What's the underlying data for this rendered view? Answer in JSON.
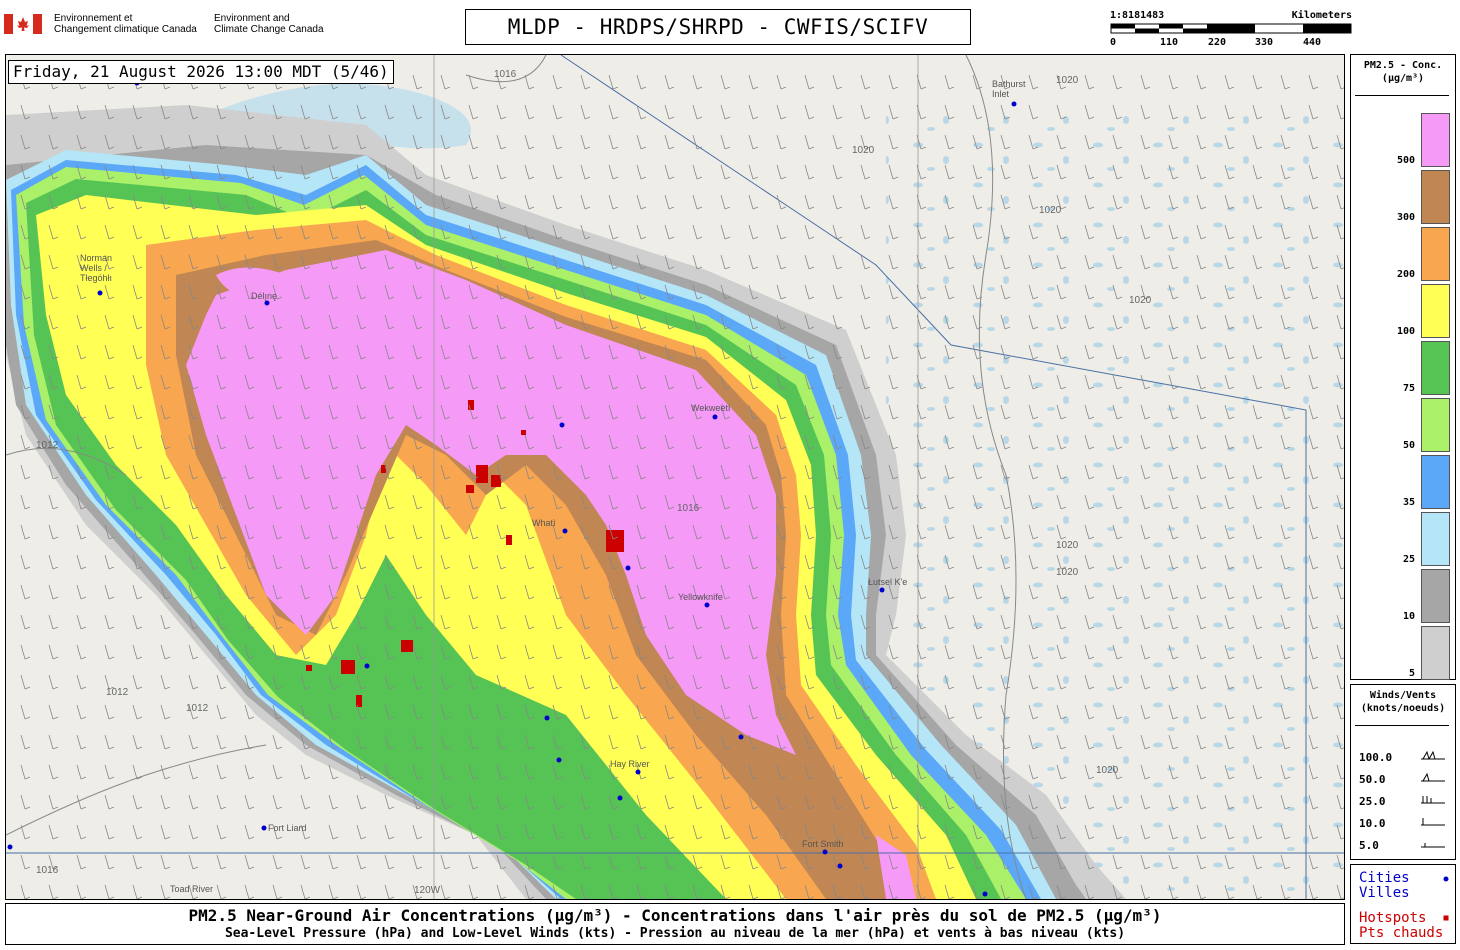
{
  "agency": {
    "fr_line1": "Environnement et",
    "fr_line2": "Changement climatique Canada",
    "en_line1": "Environment and",
    "en_line2": "Climate Change Canada",
    "flag_color": "#d52b1e"
  },
  "title": "MLDP - HRDPS/SHRPD - CWFIS/SCIFV",
  "scale": {
    "ratio": "1:8181483",
    "unit": "Kilometers",
    "ticks": [
      "0",
      "110",
      "220",
      "330",
      "440"
    ]
  },
  "timestamp": "Friday, 21 August 2026 13:00 MDT (5/46)",
  "legend_concentration": {
    "title_line1": "PM2.5 - Conc.",
    "title_line2": "(µg/m³)",
    "levels": [
      {
        "label": "500",
        "color": "#f59af6"
      },
      {
        "label": "300",
        "color": "#c08654"
      },
      {
        "label": "200",
        "color": "#f8a64f"
      },
      {
        "label": "100",
        "color": "#ffff55"
      },
      {
        "label": "75",
        "color": "#55c455"
      },
      {
        "label": "50",
        "color": "#aaf069"
      },
      {
        "label": "35",
        "color": "#5aa8f7"
      },
      {
        "label": "25",
        "color": "#b4e6f8"
      },
      {
        "label": "10",
        "color": "#a6a6a6"
      },
      {
        "label": "5",
        "color": "#cfcfcf"
      }
    ]
  },
  "legend_wind": {
    "title_line1": "Winds/Vents",
    "title_line2": "(knots/noeuds)",
    "speeds": [
      "100.0",
      "50.0",
      "25.0",
      "10.0",
      "5.0"
    ]
  },
  "legend_markers": {
    "cities_en": "Cities",
    "cities_fr": "Villes",
    "city_color": "#0000cc",
    "hotspots_en": "Hotspots",
    "hotspots_fr": "Pts chauds",
    "hotspot_color": "#cc0000"
  },
  "footer": {
    "line1": "PM2.5 Near-Ground Air Concentrations (µg/m³) - Concentrations dans l'air près du sol de PM2.5 (µg/m³)",
    "line2": "Sea-Level Pressure (hPa) and Low-Level Winds (kts) - Pression au niveau de la mer (hPa) et vents à bas niveau (kts)"
  },
  "map": {
    "cities": [
      "Norman Wells / Tłegóhłı",
      "Délı̨nę",
      "Whatì",
      "Wekweètì",
      "Yellowknife",
      "Łutsel K'e",
      "Hay River",
      "Fort Smith",
      "Fort Liard",
      "Bathurst Inlet",
      "Toad River"
    ],
    "isobars": [
      "1016",
      "1020",
      "1012"
    ],
    "meridian_label": "120W"
  }
}
